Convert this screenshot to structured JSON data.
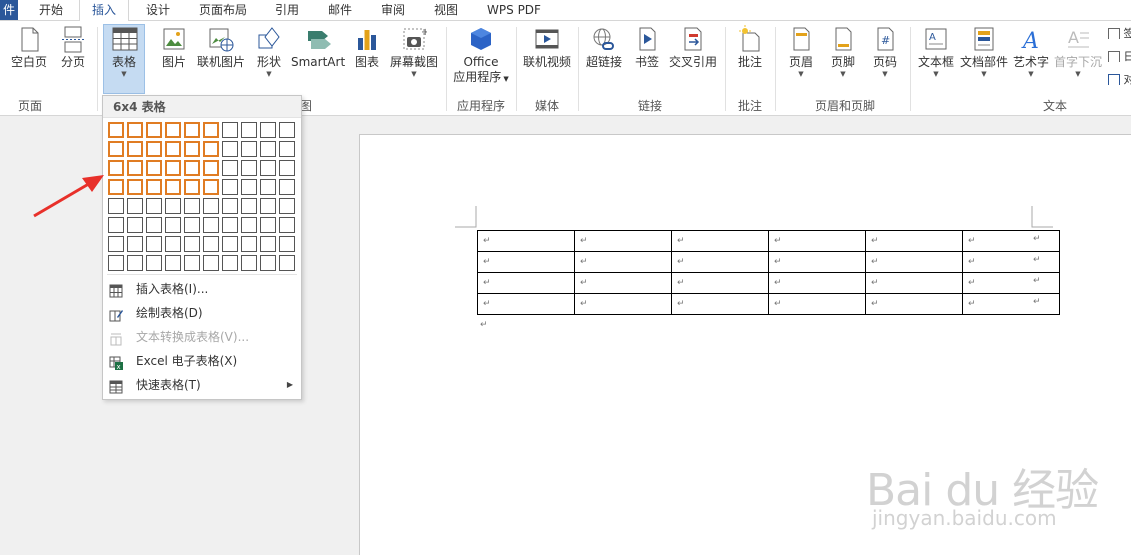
{
  "tabs": {
    "file": "件",
    "home": "开始",
    "insert": "插入",
    "design": "设计",
    "layout": "页面布局",
    "references": "引用",
    "mailings": "邮件",
    "review": "审阅",
    "view": "视图",
    "wpspdf": "WPS PDF"
  },
  "ribbon": {
    "blank_page": "空白页",
    "page_break": "分页",
    "table": "表格",
    "picture": "图片",
    "online_picture": "联机图片",
    "shapes": "形状",
    "smartart": "SmartArt",
    "chart": "图表",
    "screenshot": "屏幕截图",
    "office_line1": "Office",
    "office_line2": "应用程序",
    "online_video": "联机视频",
    "hyperlink": "超链接",
    "bookmark": "书签",
    "cross_ref": "交叉引用",
    "comment": "批注",
    "header": "页眉",
    "footer": "页脚",
    "page_number": "页码",
    "textbox": "文本框",
    "quick_parts": "文档部件",
    "wordart": "艺术字",
    "drop_cap": "首字下沉",
    "edge1": "签",
    "edge2": "日",
    "edge3": "对",
    "groups": {
      "pages": "页面",
      "illustrations": "图",
      "apps": "应用程序",
      "media": "媒体",
      "links": "链接",
      "comments": "批注",
      "header_footer": "页眉和页脚",
      "text": "文本"
    }
  },
  "dropdown": {
    "header": "6x4 表格",
    "grid": {
      "rows": 8,
      "cols": 10,
      "selected_cols": 6,
      "selected_rows": 4
    },
    "items": [
      {
        "label": "插入表格(I)...",
        "icon": "table-icon",
        "disabled": false
      },
      {
        "label": "绘制表格(D)",
        "icon": "pencil-table-icon",
        "disabled": false
      },
      {
        "label": "文本转换成表格(V)...",
        "icon": "text-to-table-icon",
        "disabled": true
      },
      {
        "label": "Excel 电子表格(X)",
        "icon": "excel-icon",
        "disabled": false
      },
      {
        "label": "快速表格(T)",
        "icon": "quick-table-icon",
        "disabled": false
      }
    ]
  },
  "document": {
    "table": {
      "rows": 4,
      "cols": 6,
      "cell_mark": "↵"
    },
    "para_mark": "↵"
  },
  "watermark": {
    "logo": "Bai du 经验",
    "url": "jingyan.baidu.com"
  },
  "colors": {
    "accent": "#2b579a",
    "selection": "#e07c23",
    "arrow": "#e8302a",
    "active_button": "#c5dbf2"
  }
}
